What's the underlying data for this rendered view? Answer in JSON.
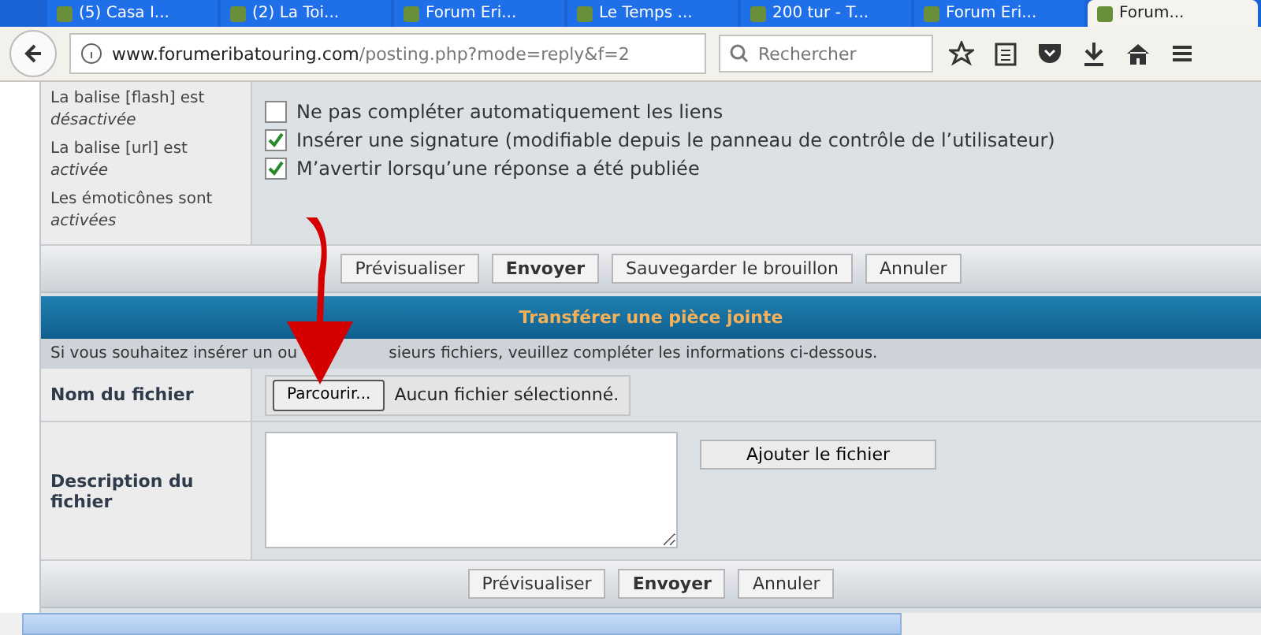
{
  "browser": {
    "tabs": [
      {
        "label": "(5) Casa I...",
        "selected": false
      },
      {
        "label": "(2) La Toi...",
        "selected": false
      },
      {
        "label": "Forum Eri...",
        "selected": false
      },
      {
        "label": "Le Temps ...",
        "selected": false
      },
      {
        "label": "200 tur - T...",
        "selected": false
      },
      {
        "label": "Forum Eri...",
        "selected": false
      },
      {
        "label": "Forum...",
        "selected": true
      }
    ],
    "url_host": "www.forumeribatouring.com",
    "url_path": "/posting.php?mode=reply&f=2",
    "search": {
      "placeholder": "Rechercher"
    }
  },
  "options": {
    "rules": [
      {
        "text": "La balise [flash] est",
        "state": "désactivée"
      },
      {
        "text": "La balise [url] est",
        "state": "activée"
      },
      {
        "text": "Les émoticônes sont",
        "state": "activées"
      }
    ],
    "checkboxes": [
      {
        "label": "Ne pas compléter automatiquement les liens",
        "checked": false
      },
      {
        "label": "Insérer une signature (modifiable depuis le panneau de contrôle de l’utilisateur)",
        "checked": true
      },
      {
        "label": "M’avertir lorsqu’une réponse a été publiée",
        "checked": true
      }
    ]
  },
  "post_buttons": [
    {
      "label": "Prévisualiser",
      "primary": false
    },
    {
      "label": "Envoyer",
      "primary": true
    },
    {
      "label": "Sauvegarder le brouillon",
      "primary": false
    },
    {
      "label": "Annuler",
      "primary": false
    }
  ],
  "attachment": {
    "title": "Transférer une pièce jointe",
    "info_before": "Si vous souhaitez insérer un ou",
    "info_after": "sieurs fichiers, veuillez compléter les informations ci-dessous.",
    "file_label": "Nom du fichier",
    "browse_button": "Parcourir...",
    "file_status": "Aucun fichier sélectionné.",
    "description_label": "Description du fichier",
    "add_button": "Ajouter le fichier"
  },
  "bottom_buttons": [
    {
      "label": "Prévisualiser",
      "primary": false
    },
    {
      "label": "Envoyer",
      "primary": true
    },
    {
      "label": "Annuler",
      "primary": false
    }
  ]
}
